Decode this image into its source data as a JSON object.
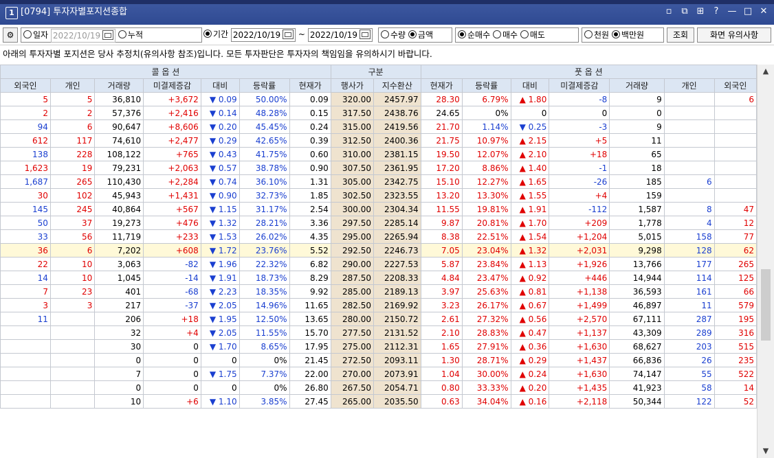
{
  "window": {
    "number": "1",
    "title": "[0794] 투자자별포지션종합",
    "controls": [
      "▫",
      "⧉",
      "⊞",
      "?",
      "—",
      "□",
      "✕"
    ]
  },
  "toolbar": {
    "gear_icon": "gear-icon",
    "daily_label": "일자",
    "daily_date": "2022/10/19",
    "cumulative_label": "누적",
    "period_label": "기간",
    "period_start": "2022/10/19",
    "tilde": "~",
    "period_end": "2022/10/19",
    "qty_label": "수량",
    "amount_label": "금액",
    "net_buy_label": "순매수",
    "buy_label": "매수",
    "sell_label": "매도",
    "thousand_label": "천원",
    "million_label": "백만원",
    "query_button": "조회",
    "notes_button": "화면 유의사항",
    "selected": {
      "date_mode": "기간",
      "measure": "금액",
      "side": "순매수",
      "unit": "백만원"
    }
  },
  "notice": "아래의 투자자별 포지션은 당사 추정치(유의사항 참조)입니다. 모든 투자판단은 투자자의 책임임을 유의하시기 바랍니다.",
  "table": {
    "group_headers": {
      "call": "콜 옵 션",
      "middle": "구분",
      "put": "풋 옵 션"
    },
    "columns": [
      "외국인",
      "개인",
      "거래량",
      "미결제증감",
      "대비",
      "등락률",
      "현재가",
      "행사가",
      "지수환산",
      "현재가",
      "등락률",
      "대비",
      "미결제증감",
      "거래량",
      "개인",
      "외국인"
    ],
    "rows": [
      [
        "5",
        "5",
        "36,810",
        "+3,672",
        "▼ 0.09",
        "50.00%",
        "0.09",
        "320.00",
        "2457.97",
        "28.30",
        "6.79%",
        "▲ 1.80",
        "-8",
        "9",
        "",
        "6"
      ],
      [
        "2",
        "2",
        "57,376",
        "+2,416",
        "▼ 0.14",
        "48.28%",
        "0.15",
        "317.50",
        "2438.76",
        "24.65",
        "0%",
        "0",
        "0",
        "0",
        "",
        ""
      ],
      [
        "94",
        "6",
        "90,647",
        "+8,606",
        "▼ 0.20",
        "45.45%",
        "0.24",
        "315.00",
        "2419.56",
        "21.70",
        "1.14%",
        "▼ 0.25",
        "-3",
        "9",
        "",
        ""
      ],
      [
        "612",
        "117",
        "74,610",
        "+2,477",
        "▼ 0.29",
        "42.65%",
        "0.39",
        "312.50",
        "2400.36",
        "21.75",
        "10.97%",
        "▲ 2.15",
        "+5",
        "11",
        "",
        ""
      ],
      [
        "138",
        "228",
        "108,122",
        "+765",
        "▼ 0.43",
        "41.75%",
        "0.60",
        "310.00",
        "2381.15",
        "19.50",
        "12.07%",
        "▲ 2.10",
        "+18",
        "65",
        "",
        ""
      ],
      [
        "1,623",
        "19",
        "79,231",
        "+2,063",
        "▼ 0.57",
        "38.78%",
        "0.90",
        "307.50",
        "2361.95",
        "17.20",
        "8.86%",
        "▲ 1.40",
        "-1",
        "18",
        "",
        ""
      ],
      [
        "1,687",
        "265",
        "110,430",
        "+2,284",
        "▼ 0.74",
        "36.10%",
        "1.31",
        "305.00",
        "2342.75",
        "15.10",
        "12.27%",
        "▲ 1.65",
        "-26",
        "185",
        "6",
        ""
      ],
      [
        "30",
        "102",
        "45,943",
        "+1,431",
        "▼ 0.90",
        "32.73%",
        "1.85",
        "302.50",
        "2323.55",
        "13.20",
        "13.30%",
        "▲ 1.55",
        "+4",
        "159",
        "",
        ""
      ],
      [
        "145",
        "245",
        "40,864",
        "+567",
        "▼ 1.15",
        "31.17%",
        "2.54",
        "300.00",
        "2304.34",
        "11.55",
        "19.81%",
        "▲ 1.91",
        "-112",
        "1,587",
        "8",
        "47"
      ],
      [
        "50",
        "37",
        "19,273",
        "+476",
        "▼ 1.32",
        "28.21%",
        "3.36",
        "297.50",
        "2285.14",
        "9.87",
        "20.81%",
        "▲ 1.70",
        "+209",
        "1,778",
        "4",
        "12"
      ],
      [
        "33",
        "56",
        "11,719",
        "+233",
        "▼ 1.53",
        "26.02%",
        "4.35",
        "295.00",
        "2265.94",
        "8.38",
        "22.51%",
        "▲ 1.54",
        "+1,204",
        "5,015",
        "158",
        "77"
      ],
      [
        "36",
        "6",
        "7,202",
        "+608",
        "▼ 1.72",
        "23.76%",
        "5.52",
        "292.50",
        "2246.73",
        "7.05",
        "23.04%",
        "▲ 1.32",
        "+2,031",
        "9,298",
        "128",
        "62"
      ],
      [
        "22",
        "10",
        "3,063",
        "-82",
        "▼ 1.96",
        "22.32%",
        "6.82",
        "290.00",
        "2227.53",
        "5.87",
        "23.84%",
        "▲ 1.13",
        "+1,926",
        "13,766",
        "177",
        "265"
      ],
      [
        "14",
        "10",
        "1,045",
        "-14",
        "▼ 1.91",
        "18.73%",
        "8.29",
        "287.50",
        "2208.33",
        "4.84",
        "23.47%",
        "▲ 0.92",
        "+446",
        "14,944",
        "114",
        "125"
      ],
      [
        "7",
        "23",
        "401",
        "-68",
        "▼ 2.23",
        "18.35%",
        "9.92",
        "285.00",
        "2189.13",
        "3.97",
        "25.63%",
        "▲ 0.81",
        "+1,138",
        "36,593",
        "161",
        "66"
      ],
      [
        "3",
        "3",
        "217",
        "-37",
        "▼ 2.05",
        "14.96%",
        "11.65",
        "282.50",
        "2169.92",
        "3.23",
        "26.17%",
        "▲ 0.67",
        "+1,499",
        "46,897",
        "11",
        "579"
      ],
      [
        "11",
        "",
        "206",
        "+18",
        "▼ 1.95",
        "12.50%",
        "13.65",
        "280.00",
        "2150.72",
        "2.61",
        "27.32%",
        "▲ 0.56",
        "+2,570",
        "67,111",
        "287",
        "195"
      ],
      [
        "",
        "",
        "32",
        "+4",
        "▼ 2.05",
        "11.55%",
        "15.70",
        "277.50",
        "2131.52",
        "2.10",
        "28.83%",
        "▲ 0.47",
        "+1,137",
        "43,309",
        "289",
        "316"
      ],
      [
        "",
        "",
        "30",
        "0",
        "▼ 1.70",
        "8.65%",
        "17.95",
        "275.00",
        "2112.31",
        "1.65",
        "27.91%",
        "▲ 0.36",
        "+1,630",
        "68,627",
        "203",
        "515"
      ],
      [
        "",
        "",
        "0",
        "0",
        "0",
        "0%",
        "21.45",
        "272.50",
        "2093.11",
        "1.30",
        "28.71%",
        "▲ 0.29",
        "+1,437",
        "66,836",
        "26",
        "235"
      ],
      [
        "",
        "",
        "7",
        "0",
        "▼ 1.75",
        "7.37%",
        "22.00",
        "270.00",
        "2073.91",
        "1.04",
        "30.00%",
        "▲ 0.24",
        "+1,630",
        "74,147",
        "55",
        "522"
      ],
      [
        "",
        "",
        "0",
        "0",
        "0",
        "0%",
        "26.80",
        "267.50",
        "2054.71",
        "0.80",
        "33.33%",
        "▲ 0.20",
        "+1,435",
        "41,923",
        "58",
        "14"
      ],
      [
        "",
        "",
        "10",
        "+6",
        "▼ 1.10",
        "3.85%",
        "27.45",
        "265.00",
        "2035.50",
        "0.63",
        "34.04%",
        "▲ 0.16",
        "+2,118",
        "50,344",
        "122",
        "52"
      ]
    ],
    "highlight_row": 11
  },
  "scrollbar": {
    "up_icon": "scroll-up-icon",
    "down_icon": "scroll-down-icon"
  },
  "colors": {
    "title_bg": "#3554a0",
    "header_bg": "#dce6f3",
    "middle_bg": "#efe3cf",
    "highlight_bg": "#fff9d8",
    "up": "#e00000",
    "down": "#1a3fd0"
  }
}
